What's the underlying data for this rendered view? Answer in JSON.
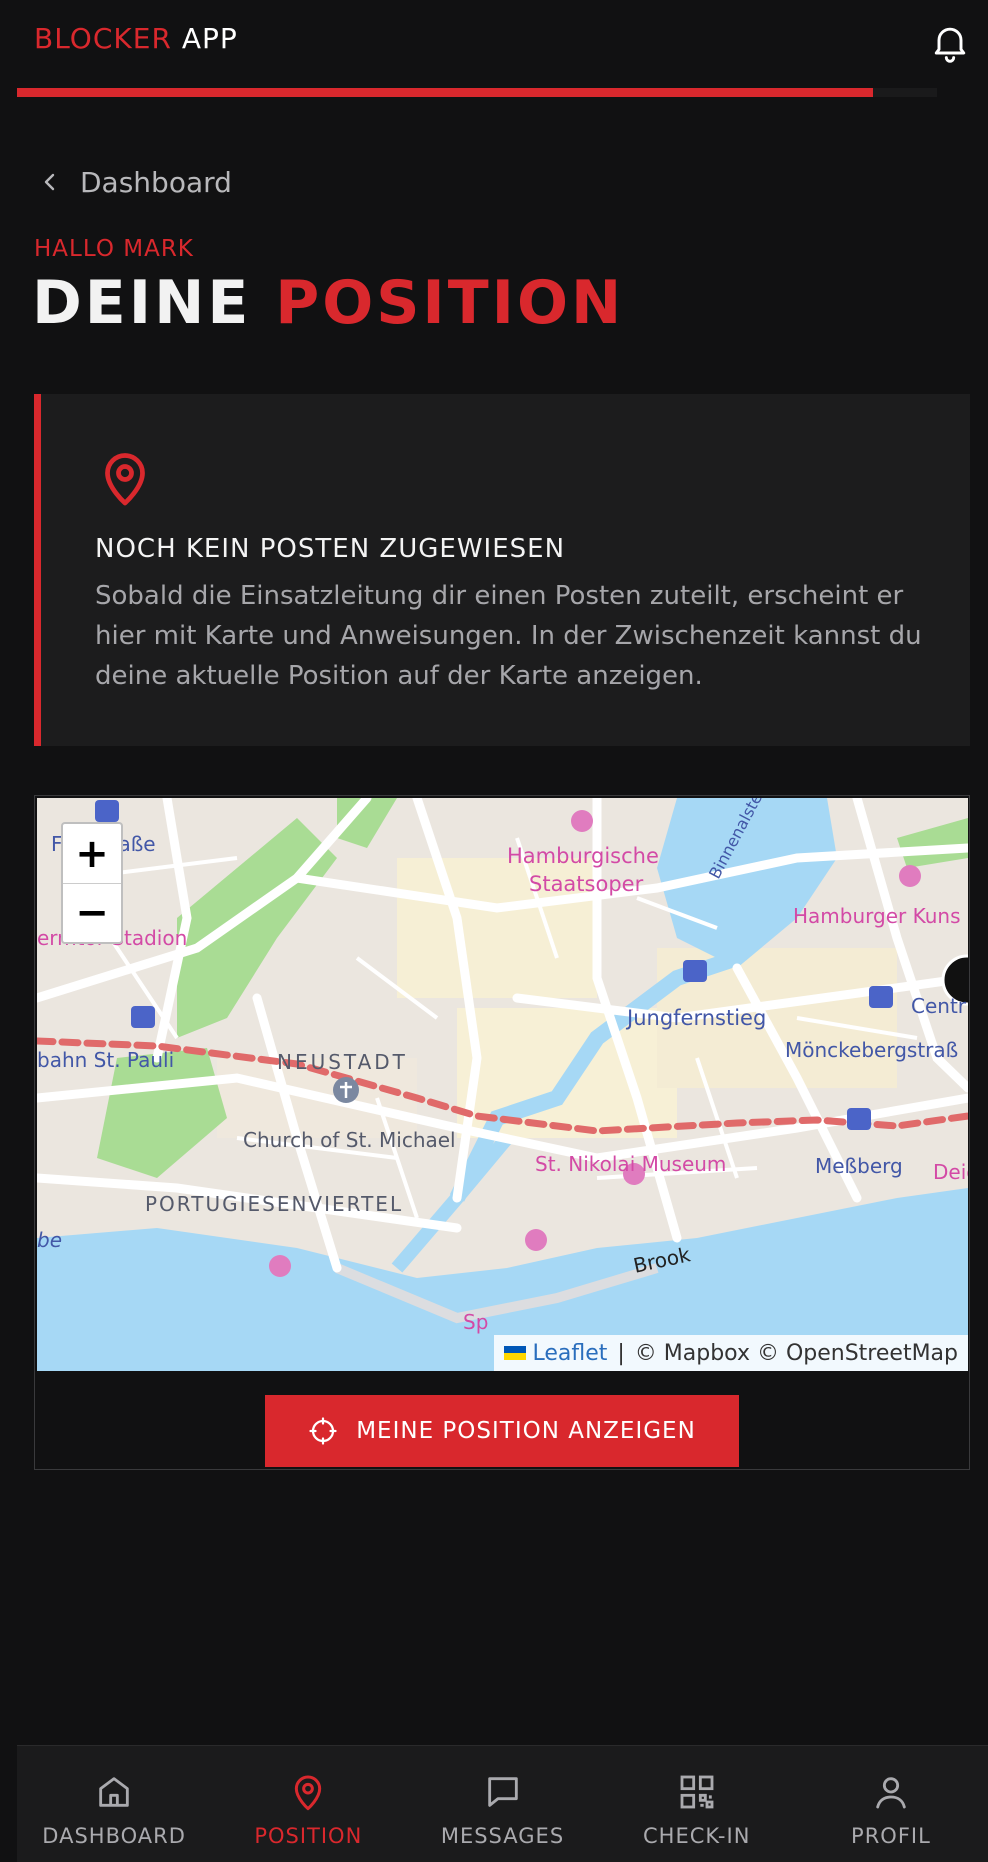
{
  "header": {
    "brand_part1": "BLOCKER",
    "brand_part2": " APP",
    "notification_icon": "bell-icon",
    "progress_fraction": 0.93,
    "accent_color": "#d9282d"
  },
  "breadcrumb": {
    "back_label": "Dashboard",
    "icon": "chevron-left-icon"
  },
  "greeting": "HALLO MARK",
  "page_title": {
    "part1": "DEINE ",
    "part2": "POSITION"
  },
  "notice": {
    "icon": "map-pin-icon",
    "title": "NOCH KEIN POSTEN ZUGEWIESEN",
    "text": "Sobald die Einsatzleitung dir einen Posten zuteilt, erscheint er hier mit Karte und Anweisungen. In der Zwischenzeit kannst du deine aktuelle Position auf der Karte anzeigen."
  },
  "map": {
    "zoom_in_label": "+",
    "zoom_out_label": "−",
    "attribution_leaflet": "Leaflet",
    "attribution_rest": "© Mapbox © OpenStreetMap",
    "labels": [
      "Feldstraße",
      "Hamburgische",
      "Staatsoper",
      "Binnenalster",
      "Hamburger Kuns",
      "ermtor Stadion",
      "Jungfernstieg",
      "Centr",
      "Mönckebergstraß",
      "bahn St. Pauli",
      "NEUSTADT",
      "Church of St. Michael",
      "St. Nikolai Museum",
      "Meßberg",
      "Deic",
      "PORTUGIESENVIERTEL",
      "be",
      "Brook",
      "Sp"
    ]
  },
  "position_button": {
    "label": "MEINE POSITION ANZEIGEN",
    "icon": "crosshair-icon"
  },
  "bottom_nav": [
    {
      "label": "DASHBOARD",
      "icon": "home-icon"
    },
    {
      "label": "POSITION",
      "icon": "map-pin-icon",
      "active": true
    },
    {
      "label": "MESSAGES",
      "icon": "message-icon"
    },
    {
      "label": "CHECK-IN",
      "icon": "qr-code-icon"
    },
    {
      "label": "PROFIL",
      "icon": "user-icon"
    }
  ]
}
